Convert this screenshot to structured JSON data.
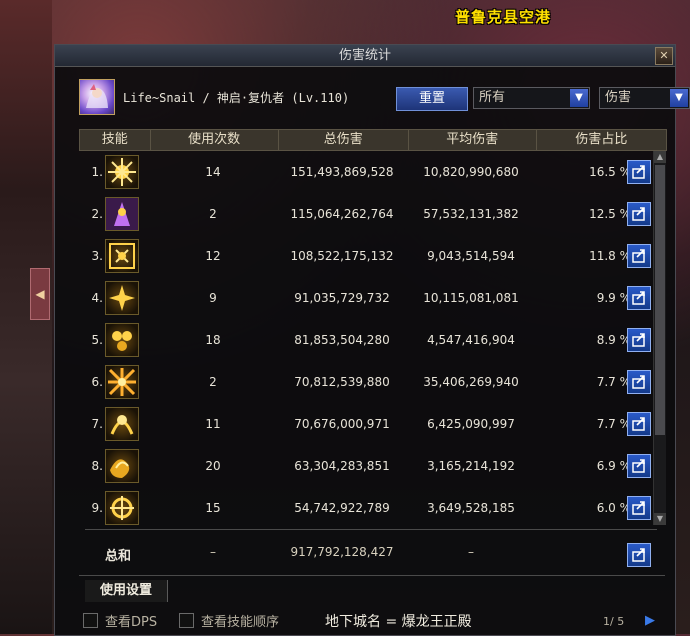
{
  "background": {
    "map_title": "普鲁克县空港"
  },
  "window": {
    "title": "伤害统计"
  },
  "header": {
    "character": "Life~Snail / 神启·复仇者 (Lv.110)",
    "reset_label": "重置",
    "filter_value": "所有",
    "mode_value": "伤害"
  },
  "table": {
    "columns": [
      "技能",
      "使用次数",
      "总伤害",
      "平均伤害",
      "伤害占比"
    ],
    "rows": [
      {
        "rank": "1.",
        "icon": "skill-icon-1",
        "count": "14",
        "total": "151,493,869,528",
        "average": "10,820,990,680",
        "share": "16.5 %"
      },
      {
        "rank": "2.",
        "icon": "skill-icon-2",
        "count": "2",
        "total": "115,064,262,764",
        "average": "57,532,131,382",
        "share": "12.5 %"
      },
      {
        "rank": "3.",
        "icon": "skill-icon-3",
        "count": "12",
        "total": "108,522,175,132",
        "average": "9,043,514,594",
        "share": "11.8 %"
      },
      {
        "rank": "4.",
        "icon": "skill-icon-4",
        "count": "9",
        "total": "91,035,729,732",
        "average": "10,115,081,081",
        "share": "9.9 %"
      },
      {
        "rank": "5.",
        "icon": "skill-icon-5",
        "count": "18",
        "total": "81,853,504,280",
        "average": "4,547,416,904",
        "share": "8.9 %"
      },
      {
        "rank": "6.",
        "icon": "skill-icon-6",
        "count": "2",
        "total": "70,812,539,880",
        "average": "35,406,269,940",
        "share": "7.7 %"
      },
      {
        "rank": "7.",
        "icon": "skill-icon-7",
        "count": "11",
        "total": "70,676,000,971",
        "average": "6,425,090,997",
        "share": "7.7 %"
      },
      {
        "rank": "8.",
        "icon": "skill-icon-8",
        "count": "20",
        "total": "63,304,283,851",
        "average": "3,165,214,192",
        "share": "6.9 %"
      },
      {
        "rank": "9.",
        "icon": "skill-icon-9",
        "count": "15",
        "total": "54,742,922,789",
        "average": "3,649,528,185",
        "share": "6.0 %"
      }
    ],
    "total": {
      "label": "总和",
      "count": "–",
      "total": "917,792,128,427",
      "average": "–"
    }
  },
  "tabs": {
    "settings": "使用设置"
  },
  "footer": {
    "show_dps": "查看DPS",
    "show_order": "查看技能顺序",
    "dungeon": "地下城名 = 爆龙王正殿",
    "page": "1/ 5"
  },
  "colors": {
    "accent_gold": "#ffd24a",
    "button_blue": "#2a5ac8"
  }
}
